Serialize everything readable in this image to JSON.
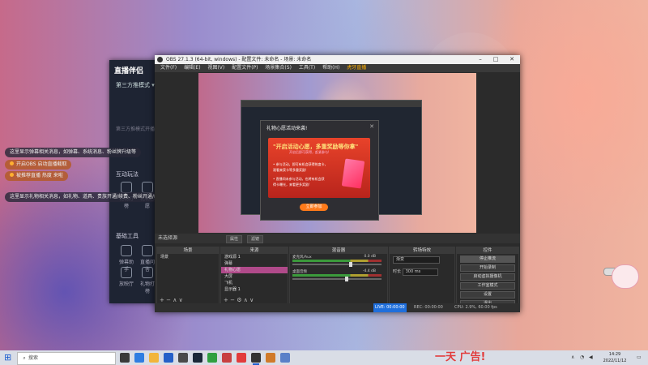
{
  "companion": {
    "logo": "直播伴侣",
    "mode": "第三方推模式 ▾",
    "mode_faded": "第三方推模式开播",
    "section_interact": "互动玩法",
    "section_basic": "基础工具",
    "tools": [
      "礼物打榜",
      "礼物心愿"
    ],
    "tools2": [
      "弹幕助手",
      "直播问答",
      "放映厅"
    ],
    "notices": [
      "这里显示弹幕相关消息，如弹幕、系统消息、粉丝牌升级等",
      "开启OBS 启动直播截取",
      "被推荐直播 热度 来啦",
      "这里显示礼物相关消息，如礼物、道具、贵族开通/续费、粉丝开通/续费等"
    ]
  },
  "obs": {
    "title": "OBS 27.1.3 (64-bit, windows) - 配置文件: 未命名 - 场景: 未命名",
    "menu": [
      "文件(F)",
      "编辑(E)",
      "视图(V)",
      "配置文件(P)",
      "场景集合(S)",
      "工具(T)",
      "帮助(H)",
      "虎牙直播"
    ],
    "scene_label": "未选择源",
    "scene_buttons": [
      "属性",
      "滤镜"
    ],
    "docks": {
      "scenes": {
        "header": "场景",
        "items": [
          "场景"
        ]
      },
      "sources": {
        "header": "来源",
        "items": [
          "游戏源 1",
          "弹幕",
          "礼物心愿",
          "大屏",
          "飞机",
          "显示器 1"
        ]
      },
      "mixer": {
        "header": "混音器",
        "channels": [
          {
            "name": "麦克风/Aux",
            "db": "0.0 dB"
          },
          {
            "name": "桌面音频",
            "db": "-4.4 dB"
          }
        ]
      },
      "transitions": {
        "header": "转场特效",
        "type": "渐变",
        "duration_label": "时长",
        "duration": "300 ms"
      },
      "controls": {
        "header": "控件",
        "buttons": [
          "停止推流",
          "开始录制",
          "启动虚拟摄像机",
          "工作室模式",
          "设置",
          "退出"
        ]
      }
    },
    "status": {
      "live": "LIVE: 00:00:00",
      "rec": "REC: 00:00:00",
      "cpu": "CPU: 2.9%, 60.00 fps"
    },
    "gift_dialog": {
      "title": "礼物心愿活动来袭!",
      "headline": "\"开启活动心愿，多重奖励等你拿\"",
      "sub": "开启后即可获得，赶紧参与!",
      "lines": [
        "• 参与活动，即可有机会获得热度卡，",
        "  观看来获卡等多重奖励!",
        "• 直播间未参与活动，也将有机会获",
        "  得卡曝光，来看更多奖励!"
      ],
      "button": "立即参加"
    }
  },
  "taskbar": {
    "search_placeholder": "搜索",
    "ad_text": "一天  广告!",
    "time": "14:29",
    "date": "2022/11/12"
  }
}
